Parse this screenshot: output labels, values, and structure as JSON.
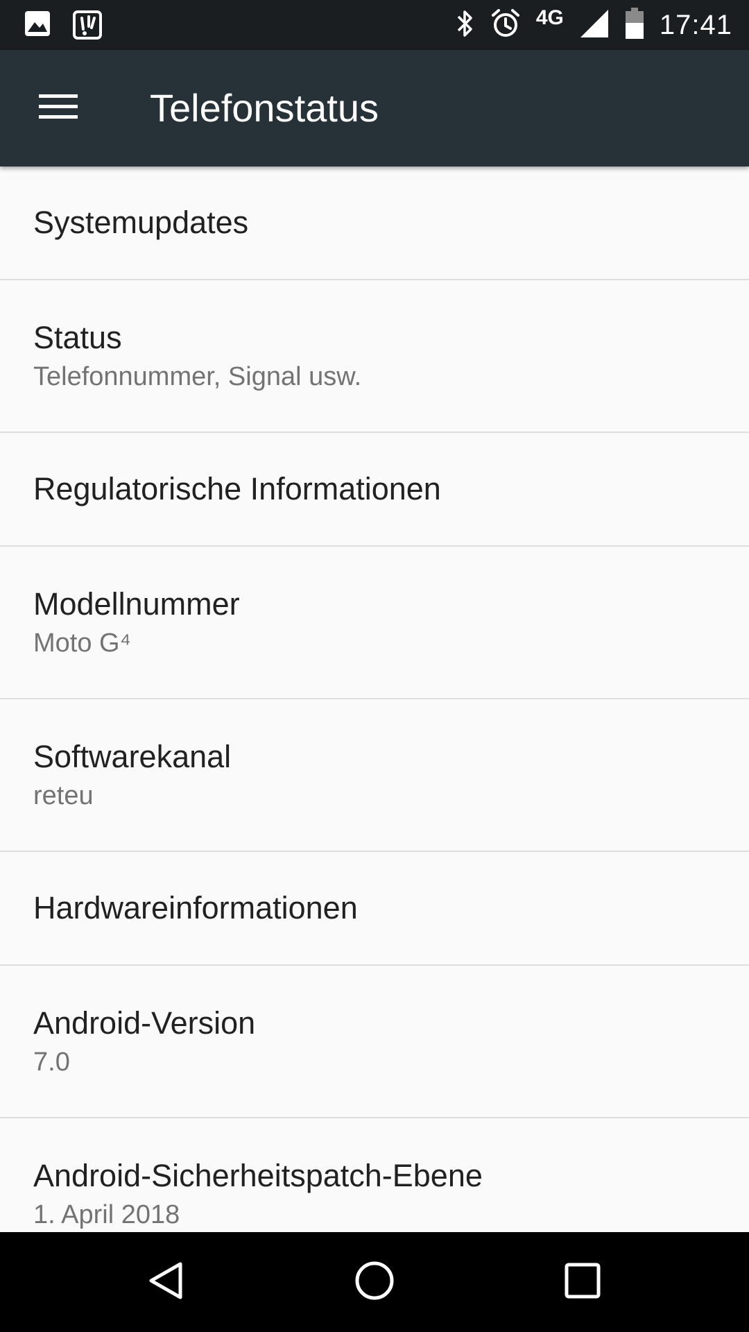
{
  "status_bar": {
    "time": "17:41",
    "network": "4G",
    "icons": [
      "image-notification-icon",
      "app-notification-icon",
      "bluetooth-icon",
      "alarm-icon",
      "signal-icon",
      "battery-icon"
    ]
  },
  "toolbar": {
    "title": "Telefonstatus",
    "menu_icon": "hamburger-menu-icon"
  },
  "items": [
    {
      "title": "Systemupdates",
      "subtitle": null
    },
    {
      "title": "Status",
      "subtitle": "Telefonnummer, Signal usw."
    },
    {
      "title": "Regulatorische Informationen",
      "subtitle": null
    },
    {
      "title": "Modellnummer",
      "subtitle": "Moto G⁴"
    },
    {
      "title": "Softwarekanal",
      "subtitle": "reteu"
    },
    {
      "title": "Hardwareinformationen",
      "subtitle": null
    },
    {
      "title": "Android-Version",
      "subtitle": "7.0"
    },
    {
      "title": "Android-Sicherheitspatch-Ebene",
      "subtitle": "1. April 2018"
    }
  ],
  "nav_bar": {
    "icons": [
      "back-icon",
      "home-icon",
      "recents-icon"
    ]
  },
  "colors": {
    "status_bar_bg": "#1b1e21",
    "toolbar_bg": "#263238",
    "list_bg": "#fafafa",
    "title_text": "#212121",
    "subtitle_text": "#737373",
    "divider": "#dddddd"
  }
}
